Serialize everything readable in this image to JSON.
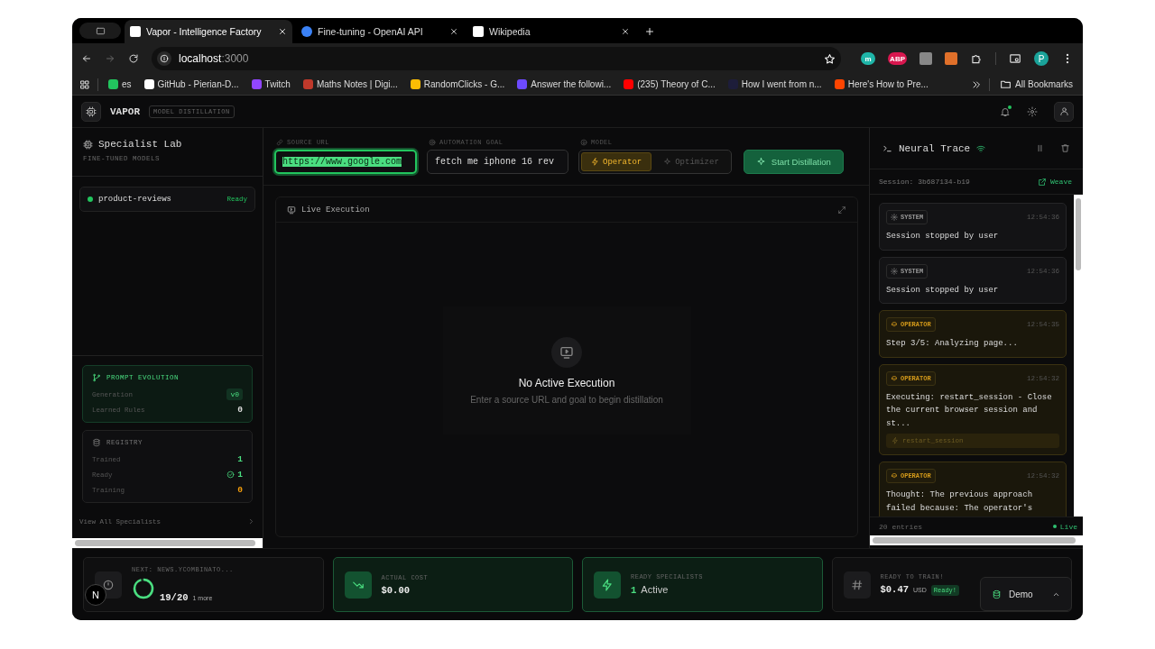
{
  "browser": {
    "tabs": [
      {
        "title": "Vapor - Intelligence Factory",
        "selected": true
      },
      {
        "title": "Fine-tuning - OpenAI API",
        "selected": false
      },
      {
        "title": "Wikipedia",
        "selected": false
      }
    ],
    "address": {
      "host": "localhost",
      "port": ":3000"
    },
    "extensions": [
      {
        "label": "m",
        "color": "#1fb5a8"
      },
      {
        "label": "ABP",
        "color": "#d8174f"
      }
    ],
    "profile": "P",
    "bookmarks": [
      {
        "label": "es",
        "color": "#22c55e"
      },
      {
        "label": "GitHub - Pierian-D...",
        "color": "#ffffff"
      },
      {
        "label": "Twitch",
        "color": "#9146ff"
      },
      {
        "label": "Maths Notes | Digi...",
        "color": "#c0392b"
      },
      {
        "label": "RandomClicks - G...",
        "color": "#fbbc04"
      },
      {
        "label": "Answer the followi...",
        "color": "#6d4aff"
      },
      {
        "label": "(235) Theory of C...",
        "color": "#ff0000"
      },
      {
        "label": "How I went from n...",
        "color": "#1d1d3a"
      },
      {
        "label": "Here's How to Pre...",
        "color": "#ff4500"
      }
    ],
    "all_bookmarks": "All Bookmarks"
  },
  "app": {
    "brand": "VAPOR",
    "badge": "MODEL DISTILLATION",
    "notification": true
  },
  "sidebar": {
    "title": "Specialist Lab",
    "subtitle": "FINE-TUNED MODELS",
    "specialists": [
      {
        "name": "product-reviews",
        "status": "Ready",
        "color": "#22c55e"
      }
    ],
    "prompt_evolution": {
      "title": "PROMPT EVOLUTION",
      "rows": [
        {
          "label": "Generation",
          "value": "v0",
          "kind": "badge"
        },
        {
          "label": "Learned Rules",
          "value": "0",
          "kind": "plain"
        }
      ]
    },
    "registry": {
      "title": "REGISTRY",
      "rows": [
        {
          "label": "Trained",
          "value": "1",
          "color": "#4ade80",
          "kind": "plain"
        },
        {
          "label": "Ready",
          "value": "1",
          "color": "#4ade80",
          "kind": "check"
        },
        {
          "label": "Training",
          "value": "0",
          "color": "#f59e0b",
          "kind": "plain"
        }
      ]
    },
    "view_all": "View All Specialists"
  },
  "controls": {
    "source_url": {
      "label": "SOURCE URL",
      "value": "https://www.google.com",
      "focused": true,
      "text_selected": true
    },
    "goal": {
      "label": "AUTOMATION GOAL",
      "value": "fetch me iphone 16 rev",
      "focused": false
    },
    "model": {
      "label": "MODEL",
      "options": [
        {
          "label": "Operator",
          "selected": true
        },
        {
          "label": "Optimizer",
          "selected": false
        }
      ]
    },
    "start": "Start Distillation"
  },
  "live": {
    "title": "Live Execution",
    "empty_title": "No Active Execution",
    "empty_hint": "Enter a source URL and goal to begin distillation"
  },
  "trace": {
    "title": "Neural Trace",
    "session": "Session: 3b687134-b19",
    "link": "Weave",
    "entries": [
      {
        "kind": "system",
        "tag": "SYSTEM",
        "time": "12:54:36",
        "text": "Session stopped by user"
      },
      {
        "kind": "system",
        "tag": "SYSTEM",
        "time": "12:54:36",
        "text": "Session stopped by user"
      },
      {
        "kind": "operator",
        "tag": "OPERATOR",
        "time": "12:54:35",
        "text": "Step 3/5: Analyzing page..."
      },
      {
        "kind": "operator",
        "tag": "OPERATOR",
        "time": "12:54:32",
        "text": "Executing: restart_session - Close the current browser session and st...",
        "tool": "restart_session"
      },
      {
        "kind": "operator",
        "tag": "OPERATOR",
        "time": "12:54:32",
        "text": "Thought: The previous approach failed because: The operator's"
      }
    ],
    "count": "20 entries",
    "live": "Live"
  },
  "stats": [
    {
      "kind": "progress",
      "label": "NEXT: NEWS.YCOMBINATO...",
      "value": "19/20",
      "extra": "1 more",
      "level": 0.95,
      "highlighted": false
    },
    {
      "kind": "cost",
      "label": "ACTUAL COST",
      "value": "$0.00",
      "highlighted": true
    },
    {
      "kind": "ready",
      "label": "READY SPECIALISTS",
      "value": "1",
      "unit": "Active",
      "highlighted": true
    },
    {
      "kind": "train",
      "label": "READY TO TRAIN!",
      "value": "$0.47",
      "unit": "USD",
      "badge": "Ready!",
      "highlighted": false
    }
  ],
  "demo": "Demo",
  "dev_badge": "N"
}
